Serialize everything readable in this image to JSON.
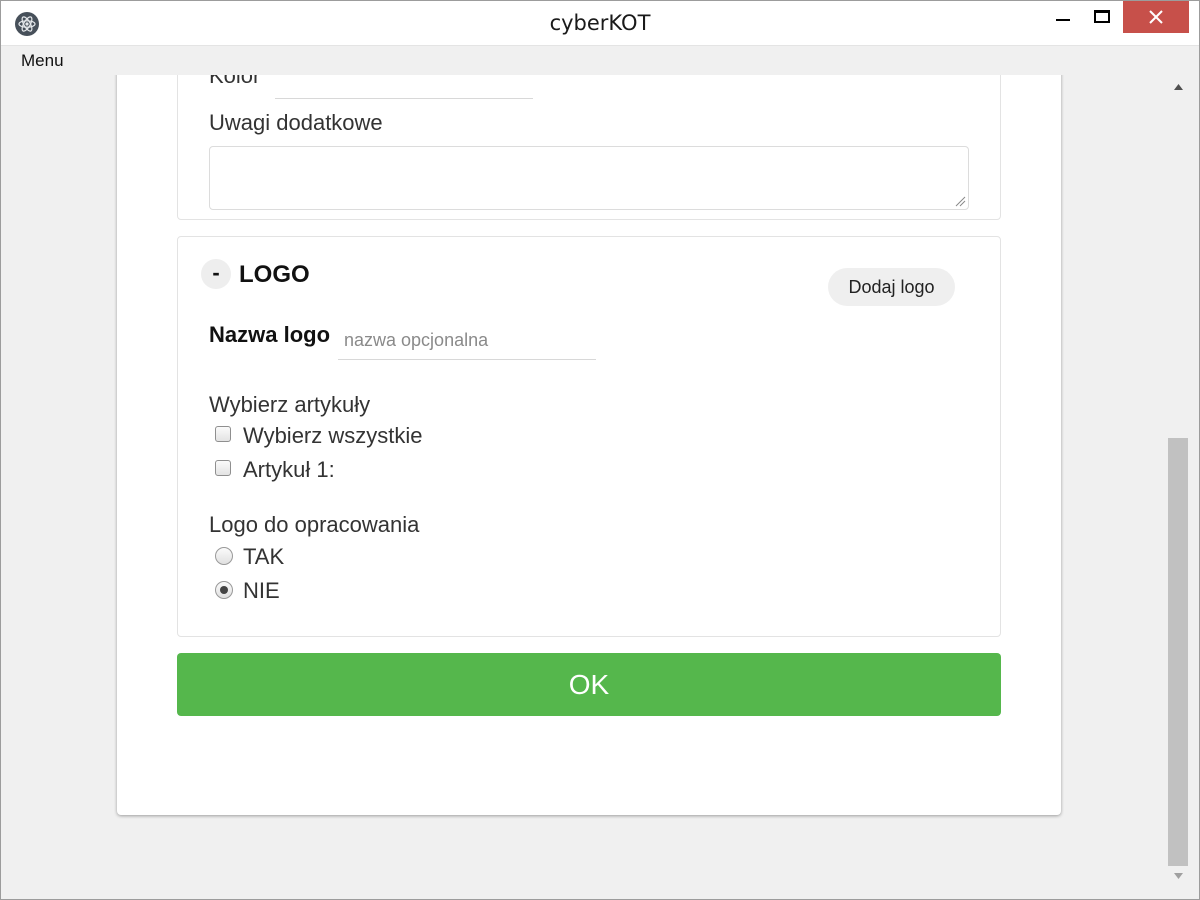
{
  "window": {
    "title": "cyberKOT",
    "close_color": "#c7504a"
  },
  "menubar": {
    "menu_label": "Menu"
  },
  "form_top": {
    "kolor_label": "Kolor",
    "kolor_value": "",
    "uwagi_label": "Uwagi dodatkowe",
    "uwagi_value": ""
  },
  "logo_section": {
    "collapse_symbol": "-",
    "title": "LOGO",
    "add_logo_label": "Dodaj logo",
    "nazwa_label": "Nazwa logo",
    "nazwa_placeholder": "nazwa opcjonalna",
    "articles_label": "Wybierz artykuły",
    "articles": [
      {
        "label": "Wybierz wszystkie",
        "checked": false
      },
      {
        "label": "Artykuł 1:",
        "checked": false
      }
    ],
    "opracowanie_label": "Logo do opracowania",
    "opracowanie_options": [
      {
        "label": "TAK",
        "selected": false
      },
      {
        "label": "NIE",
        "selected": true
      }
    ]
  },
  "submit": {
    "label": "OK",
    "color": "#55b74c"
  },
  "icons": {
    "app": "electron-atom-icon",
    "minimize": "minimize-icon",
    "maximize": "maximize-icon",
    "close": "close-icon",
    "scroll_up": "scroll-up-arrow-icon",
    "scroll_down": "scroll-down-arrow-icon"
  }
}
